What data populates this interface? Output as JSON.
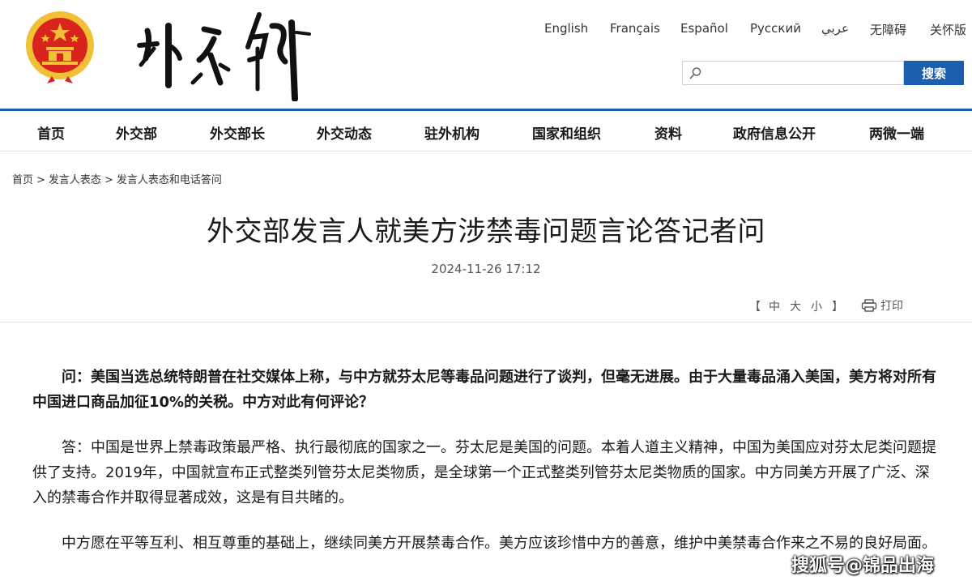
{
  "header": {
    "languages": [
      "English",
      "Français",
      "Español",
      "Русский",
      "عربي",
      "无障碍",
      "关怀版"
    ],
    "search": {
      "placeholder": "",
      "button_label": "搜索"
    },
    "colors": {
      "primary": "#1c5fae",
      "emblem_red": "#d8241d",
      "emblem_gold": "#f2c037"
    }
  },
  "nav": {
    "items": [
      "首页",
      "外交部",
      "外交部长",
      "外交动态",
      "驻外机构",
      "国家和组织",
      "资料",
      "政府信息公开",
      "两微一端"
    ]
  },
  "breadcrumb": [
    "首页",
    "发言人表态",
    "发言人表态和电话答问"
  ],
  "article": {
    "title": "外交部发言人就美方涉禁毒问题言论答记者问",
    "timestamp": "2024-11-26 17:12",
    "size_controls": {
      "open": "【",
      "large": "中",
      "medium": "大",
      "small": "小",
      "close": "】"
    },
    "print_label": "打印",
    "paragraphs": [
      {
        "type": "question",
        "text": "问：美国当选总统特朗普在社交媒体上称，与中方就芬太尼等毒品问题进行了谈判，但毫无进展。由于大量毒品涌入美国，美方将对所有中国进口商品加征10%的关税。中方对此有何评论？"
      },
      {
        "type": "answer",
        "text": "答：中国是世界上禁毒政策最严格、执行最彻底的国家之一。芬太尼是美国的问题。本着人道主义精神，中国为美国应对芬太尼类问题提供了支持。2019年，中国就宣布正式整类列管芬太尼类物质，是全球第一个正式整类列管芬太尼类物质的国家。中方同美方开展了广泛、深入的禁毒合作并取得显著成效，这是有目共睹的。"
      },
      {
        "type": "answer",
        "text": "中方愿在平等互利、相互尊重的基础上，继续同美方开展禁毒合作。美方应该珍惜中方的善意，维护中美禁毒合作来之不易的良好局面。"
      }
    ]
  },
  "watermark": "搜狐号@锦品出海"
}
